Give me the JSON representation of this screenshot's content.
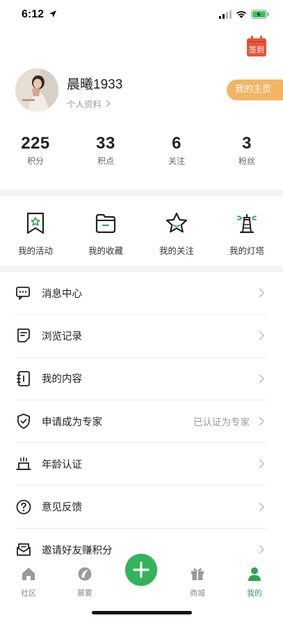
{
  "status_bar": {
    "time": "6:12"
  },
  "checkin": {
    "label": "签到"
  },
  "profile": {
    "username": "晨曦1933",
    "profile_link": "个人资料",
    "homepage_button": "我的主页"
  },
  "stats": [
    {
      "value": "225",
      "label": "积分"
    },
    {
      "value": "33",
      "label": "积点"
    },
    {
      "value": "6",
      "label": "关注"
    },
    {
      "value": "3",
      "label": "粉丝"
    }
  ],
  "quick_actions": [
    {
      "label": "我的活动",
      "icon": "bookmark-star-icon"
    },
    {
      "label": "我的收藏",
      "icon": "folder-icon"
    },
    {
      "label": "我的关注",
      "icon": "star-icon"
    },
    {
      "label": "我的灯塔",
      "icon": "lighthouse-icon"
    }
  ],
  "menu": [
    {
      "label": "消息中心",
      "icon": "message-icon",
      "extra": ""
    },
    {
      "label": "浏览记录",
      "icon": "history-doc-icon",
      "extra": ""
    },
    {
      "label": "我的内容",
      "icon": "content-notebook-icon",
      "extra": ""
    },
    {
      "label": "申请成为专家",
      "icon": "shield-check-icon",
      "extra": "已认证为专家"
    },
    {
      "label": "年龄认证",
      "icon": "cake-icon",
      "extra": ""
    },
    {
      "label": "意见反馈",
      "icon": "question-icon",
      "extra": ""
    },
    {
      "label": "邀请好友赚积分",
      "icon": "invite-mail-icon",
      "extra": ""
    }
  ],
  "tabbar": {
    "tabs": [
      {
        "label": "社区",
        "icon": "home-icon"
      },
      {
        "label": "晨雾",
        "icon": "mist-icon"
      },
      {
        "label": "商城",
        "icon": "gift-shop-icon"
      },
      {
        "label": "我的",
        "icon": "person-icon"
      }
    ],
    "active_index": 3
  },
  "colors": {
    "accent_green": "#34b25c",
    "homepage_orange": "#f3b563",
    "checkin_red": "#e8553b"
  }
}
